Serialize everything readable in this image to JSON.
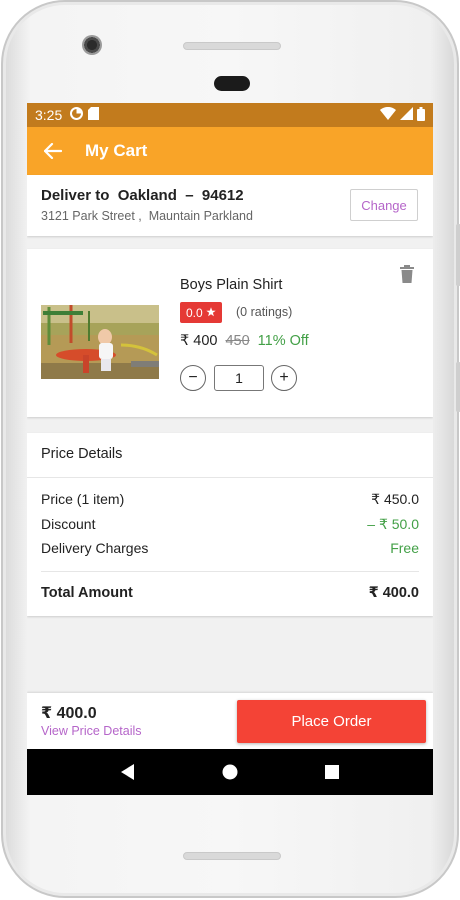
{
  "status_bar": {
    "time": "3:25"
  },
  "app_bar": {
    "title": "My Cart"
  },
  "address": {
    "deliver_to": "Deliver to  Oakland  –  94612",
    "line": "3121 Park Street ,  Mauntain Parkland",
    "change_label": "Change"
  },
  "item": {
    "name": "Boys Plain Shirt",
    "rating": "0.0",
    "ratings_count": "(0 ratings)",
    "price": "₹ 400",
    "original_price": "450",
    "discount": "11% Off",
    "quantity": "1",
    "minus_label": "−",
    "plus_label": "+"
  },
  "price_details": {
    "title": "Price Details",
    "rows": [
      {
        "label": "Price  (1 item)",
        "value": "₹ 450.0"
      },
      {
        "label": "Discount",
        "value": "– ₹ 50.0"
      },
      {
        "label": "Delivery Charges",
        "value": "Free"
      }
    ],
    "total_label": "Total Amount",
    "total_value": "₹ 400.0"
  },
  "bottom_bar": {
    "total": "₹ 400.0",
    "view_details": "View Price Details",
    "place_order": "Place Order"
  },
  "colors": {
    "status_bar": "#c27b1d",
    "app_bar": "#f9a428",
    "accent_purple": "#b565c9",
    "rating_red": "#e53935",
    "discount_green": "#43a047",
    "place_order_red": "#f44336"
  },
  "icons": {
    "back": "arrow-left-icon",
    "star": "star-icon",
    "delete": "trash-icon",
    "nav_back": "triangle-back-icon",
    "nav_home": "circle-home-icon",
    "nav_recents": "square-recents-icon"
  }
}
